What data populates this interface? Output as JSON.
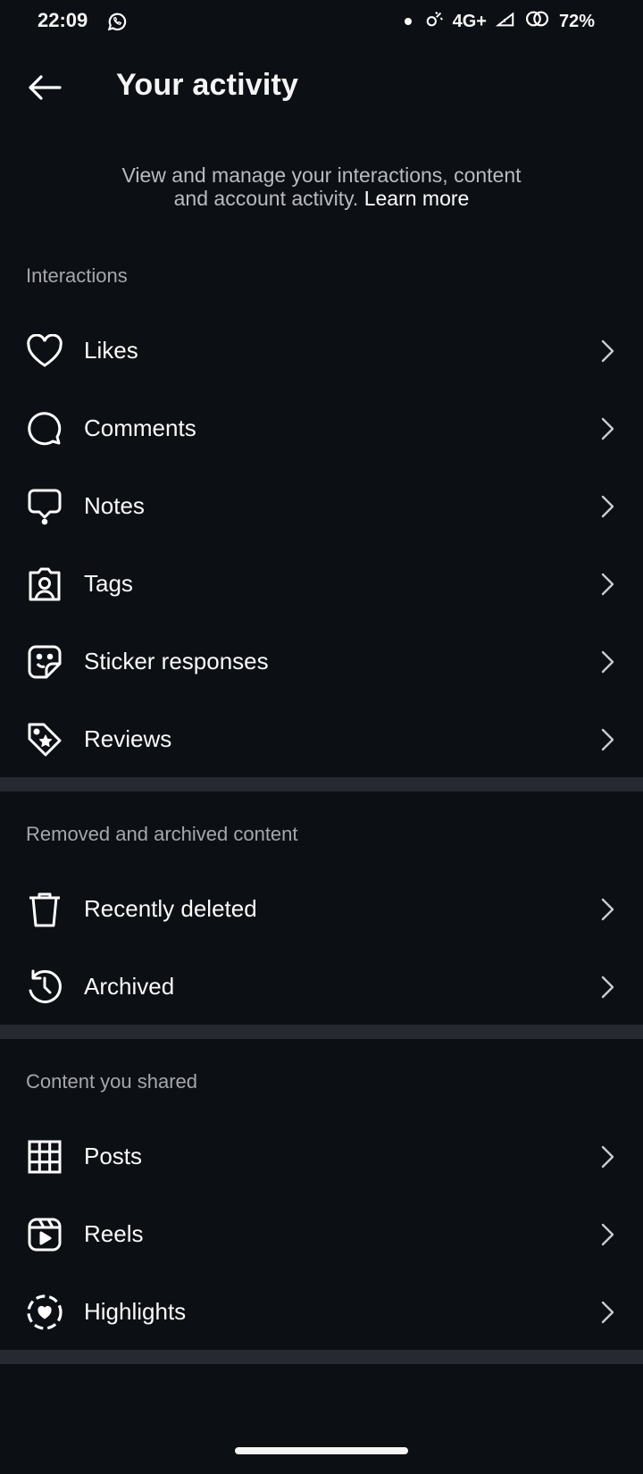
{
  "status": {
    "time": "22:09",
    "network": "4G+",
    "battery": "72%"
  },
  "header": {
    "title": "Your activity"
  },
  "intro": {
    "line1": "View and manage your interactions, content",
    "line2": "and account activity.",
    "link": "Learn more"
  },
  "sections": {
    "interactions": {
      "label": "Interactions",
      "items": [
        {
          "label": "Likes",
          "icon": "heart-icon"
        },
        {
          "label": "Comments",
          "icon": "comment-icon"
        },
        {
          "label": "Notes",
          "icon": "notes-icon"
        },
        {
          "label": "Tags",
          "icon": "tag-person-icon"
        },
        {
          "label": "Sticker responses",
          "icon": "sticker-icon"
        },
        {
          "label": "Reviews",
          "icon": "review-tag-icon"
        }
      ]
    },
    "removed": {
      "label": "Removed and archived content",
      "items": [
        {
          "label": "Recently deleted",
          "icon": "trash-icon"
        },
        {
          "label": "Archived",
          "icon": "archive-history-icon"
        }
      ]
    },
    "shared": {
      "label": "Content you shared",
      "items": [
        {
          "label": "Posts",
          "icon": "grid-icon"
        },
        {
          "label": "Reels",
          "icon": "reels-icon"
        },
        {
          "label": "Highlights",
          "icon": "highlights-icon"
        }
      ]
    }
  },
  "colors": {
    "background": "#0c0f14",
    "divider": "#26292f",
    "secondary_text": "#a4a8ae"
  }
}
